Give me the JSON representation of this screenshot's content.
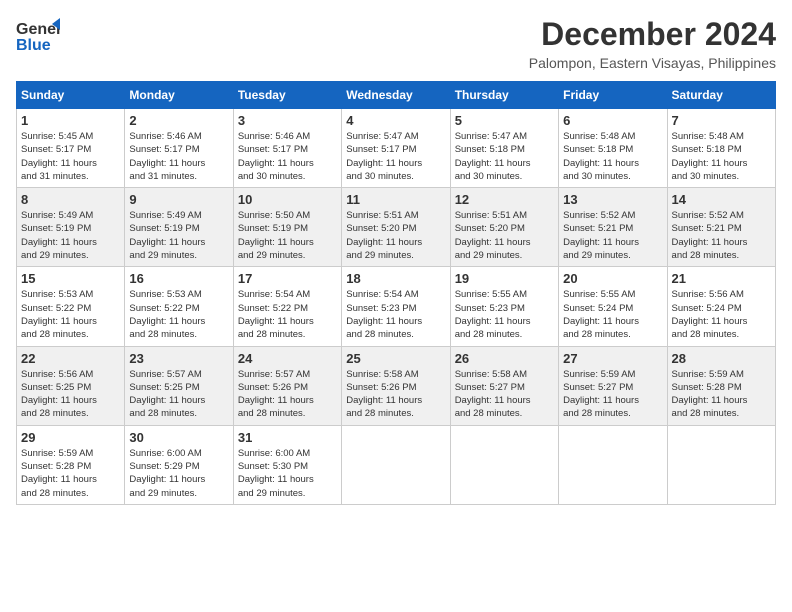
{
  "logo": {
    "line1": "General",
    "line2": "Blue"
  },
  "title": "December 2024",
  "location": "Palompon, Eastern Visayas, Philippines",
  "days_header": [
    "Sunday",
    "Monday",
    "Tuesday",
    "Wednesday",
    "Thursday",
    "Friday",
    "Saturday"
  ],
  "weeks": [
    [
      {
        "day": "1",
        "sunrise": "5:45 AM",
        "sunset": "5:17 PM",
        "daylight": "11 hours and 31 minutes."
      },
      {
        "day": "2",
        "sunrise": "5:46 AM",
        "sunset": "5:17 PM",
        "daylight": "11 hours and 31 minutes."
      },
      {
        "day": "3",
        "sunrise": "5:46 AM",
        "sunset": "5:17 PM",
        "daylight": "11 hours and 30 minutes."
      },
      {
        "day": "4",
        "sunrise": "5:47 AM",
        "sunset": "5:17 PM",
        "daylight": "11 hours and 30 minutes."
      },
      {
        "day": "5",
        "sunrise": "5:47 AM",
        "sunset": "5:18 PM",
        "daylight": "11 hours and 30 minutes."
      },
      {
        "day": "6",
        "sunrise": "5:48 AM",
        "sunset": "5:18 PM",
        "daylight": "11 hours and 30 minutes."
      },
      {
        "day": "7",
        "sunrise": "5:48 AM",
        "sunset": "5:18 PM",
        "daylight": "11 hours and 30 minutes."
      }
    ],
    [
      {
        "day": "8",
        "sunrise": "5:49 AM",
        "sunset": "5:19 PM",
        "daylight": "11 hours and 29 minutes."
      },
      {
        "day": "9",
        "sunrise": "5:49 AM",
        "sunset": "5:19 PM",
        "daylight": "11 hours and 29 minutes."
      },
      {
        "day": "10",
        "sunrise": "5:50 AM",
        "sunset": "5:19 PM",
        "daylight": "11 hours and 29 minutes."
      },
      {
        "day": "11",
        "sunrise": "5:51 AM",
        "sunset": "5:20 PM",
        "daylight": "11 hours and 29 minutes."
      },
      {
        "day": "12",
        "sunrise": "5:51 AM",
        "sunset": "5:20 PM",
        "daylight": "11 hours and 29 minutes."
      },
      {
        "day": "13",
        "sunrise": "5:52 AM",
        "sunset": "5:21 PM",
        "daylight": "11 hours and 29 minutes."
      },
      {
        "day": "14",
        "sunrise": "5:52 AM",
        "sunset": "5:21 PM",
        "daylight": "11 hours and 28 minutes."
      }
    ],
    [
      {
        "day": "15",
        "sunrise": "5:53 AM",
        "sunset": "5:22 PM",
        "daylight": "11 hours and 28 minutes."
      },
      {
        "day": "16",
        "sunrise": "5:53 AM",
        "sunset": "5:22 PM",
        "daylight": "11 hours and 28 minutes."
      },
      {
        "day": "17",
        "sunrise": "5:54 AM",
        "sunset": "5:22 PM",
        "daylight": "11 hours and 28 minutes."
      },
      {
        "day": "18",
        "sunrise": "5:54 AM",
        "sunset": "5:23 PM",
        "daylight": "11 hours and 28 minutes."
      },
      {
        "day": "19",
        "sunrise": "5:55 AM",
        "sunset": "5:23 PM",
        "daylight": "11 hours and 28 minutes."
      },
      {
        "day": "20",
        "sunrise": "5:55 AM",
        "sunset": "5:24 PM",
        "daylight": "11 hours and 28 minutes."
      },
      {
        "day": "21",
        "sunrise": "5:56 AM",
        "sunset": "5:24 PM",
        "daylight": "11 hours and 28 minutes."
      }
    ],
    [
      {
        "day": "22",
        "sunrise": "5:56 AM",
        "sunset": "5:25 PM",
        "daylight": "11 hours and 28 minutes."
      },
      {
        "day": "23",
        "sunrise": "5:57 AM",
        "sunset": "5:25 PM",
        "daylight": "11 hours and 28 minutes."
      },
      {
        "day": "24",
        "sunrise": "5:57 AM",
        "sunset": "5:26 PM",
        "daylight": "11 hours and 28 minutes."
      },
      {
        "day": "25",
        "sunrise": "5:58 AM",
        "sunset": "5:26 PM",
        "daylight": "11 hours and 28 minutes."
      },
      {
        "day": "26",
        "sunrise": "5:58 AM",
        "sunset": "5:27 PM",
        "daylight": "11 hours and 28 minutes."
      },
      {
        "day": "27",
        "sunrise": "5:59 AM",
        "sunset": "5:27 PM",
        "daylight": "11 hours and 28 minutes."
      },
      {
        "day": "28",
        "sunrise": "5:59 AM",
        "sunset": "5:28 PM",
        "daylight": "11 hours and 28 minutes."
      }
    ],
    [
      {
        "day": "29",
        "sunrise": "5:59 AM",
        "sunset": "5:28 PM",
        "daylight": "11 hours and 28 minutes."
      },
      {
        "day": "30",
        "sunrise": "6:00 AM",
        "sunset": "5:29 PM",
        "daylight": "11 hours and 29 minutes."
      },
      {
        "day": "31",
        "sunrise": "6:00 AM",
        "sunset": "5:30 PM",
        "daylight": "11 hours and 29 minutes."
      },
      null,
      null,
      null,
      null
    ]
  ],
  "labels": {
    "sunrise": "Sunrise:",
    "sunset": "Sunset:",
    "daylight": "Daylight: 11 hours"
  }
}
